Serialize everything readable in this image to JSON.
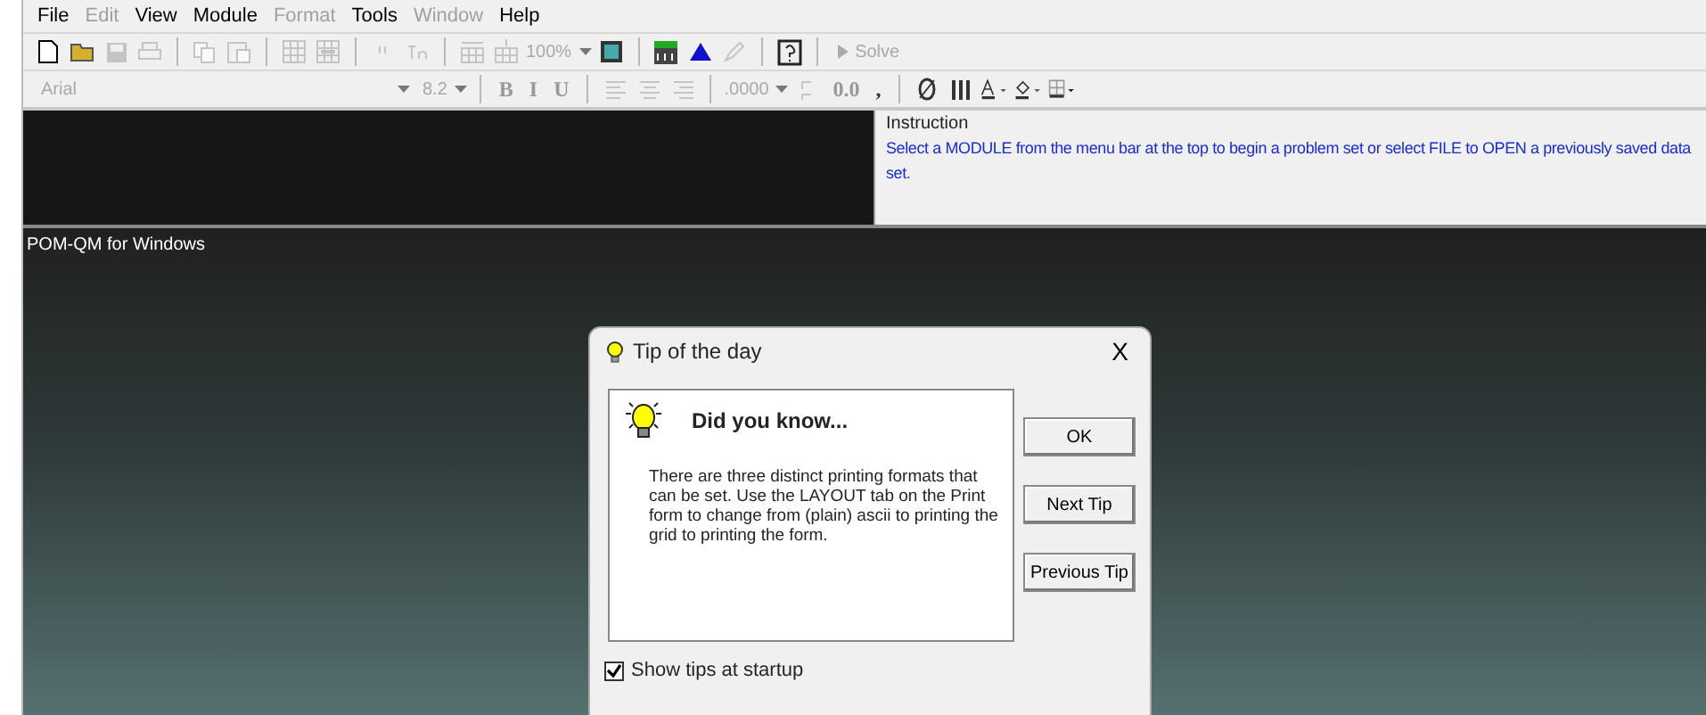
{
  "menu": [
    {
      "label": "File",
      "disabled": false
    },
    {
      "label": "Edit",
      "disabled": true
    },
    {
      "label": "View",
      "disabled": false
    },
    {
      "label": "Module",
      "disabled": false
    },
    {
      "label": "Format",
      "disabled": true
    },
    {
      "label": "Tools",
      "disabled": false
    },
    {
      "label": "Window",
      "disabled": true
    },
    {
      "label": "Help",
      "disabled": false
    }
  ],
  "toolbar": [
    {
      "kind": "icon",
      "disabled": false
    },
    {
      "kind": "icon",
      "disabled": false
    },
    {
      "kind": "icon",
      "disabled": true
    },
    {
      "kind": "icon",
      "disabled": true
    },
    {
      "kind": "separator"
    },
    {
      "kind": "icon",
      "disabled": true
    },
    {
      "kind": "icon",
      "disabled": true
    },
    {
      "kind": "separator"
    },
    {
      "kind": "icon",
      "disabled": true
    },
    {
      "kind": "icon",
      "disabled": true
    },
    {
      "kind": "separator"
    },
    {
      "kind": "icon",
      "disabled": true
    },
    {
      "kind": "icon",
      "disabled": true
    },
    {
      "kind": "separator"
    },
    {
      "kind": "icon",
      "disabled": true
    },
    {
      "kind": "icon",
      "disabled": true
    },
    {
      "kind": "combo",
      "value": "100%",
      "disabled": true
    },
    {
      "kind": "icon",
      "disabled": false
    },
    {
      "kind": "separator"
    },
    {
      "kind": "icon",
      "disabled": false
    },
    {
      "kind": "icon",
      "disabled": false
    },
    {
      "kind": "icon",
      "disabled": true
    },
    {
      "kind": "separator"
    },
    {
      "kind": "icon",
      "disabled": false
    },
    {
      "kind": "separator"
    },
    {
      "kind": "button",
      "label": "Solve",
      "disabled": true
    }
  ],
  "format_bar": [
    {
      "kind": "font",
      "value": "Arial",
      "disabled": true
    },
    {
      "kind": "combo",
      "value": "8.2",
      "disabled": true
    },
    {
      "kind": "separator"
    },
    {
      "kind": "glyph",
      "label": "B",
      "disabled": true
    },
    {
      "kind": "glyph",
      "label": "I",
      "disabled": true
    },
    {
      "kind": "glyph",
      "label": "U",
      "disabled": true
    },
    {
      "kind": "separator"
    },
    {
      "kind": "icon",
      "disabled": true
    },
    {
      "kind": "icon",
      "disabled": true
    },
    {
      "kind": "icon",
      "disabled": true
    },
    {
      "kind": "separator"
    },
    {
      "kind": "combo",
      "value": ".0000",
      "disabled": true
    },
    {
      "kind": "icon",
      "disabled": true
    },
    {
      "kind": "glyph",
      "label": "0.0",
      "disabled": true
    },
    {
      "kind": "glyph",
      "label": ",",
      "disabled": false
    },
    {
      "kind": "separator"
    },
    {
      "kind": "icon",
      "disabled": false
    },
    {
      "kind": "icon",
      "disabled": false
    },
    {
      "kind": "icon",
      "disabled": false
    },
    {
      "kind": "icon",
      "disabled": false
    },
    {
      "kind": "icon",
      "disabled": false
    }
  ],
  "instruction": {
    "title": "Instruction",
    "text": "Select a MODULE from the menu bar at the top to begin a problem set or select FILE to OPEN a previously saved data set."
  },
  "workspace": {
    "title": "POM-QM for Windows"
  },
  "dialog": {
    "title": "Tip of the day",
    "close": "X",
    "heading": "Did you know...",
    "tip": "There are three distinct printing formats that can be set. Use the LAYOUT tab on the Print form to change from (plain) ascii to printing the grid to printing the form.",
    "buttons": [
      "OK",
      "Next Tip",
      "Previous Tip"
    ],
    "show_tips": {
      "label": "Show tips at startup",
      "checked": true
    }
  }
}
